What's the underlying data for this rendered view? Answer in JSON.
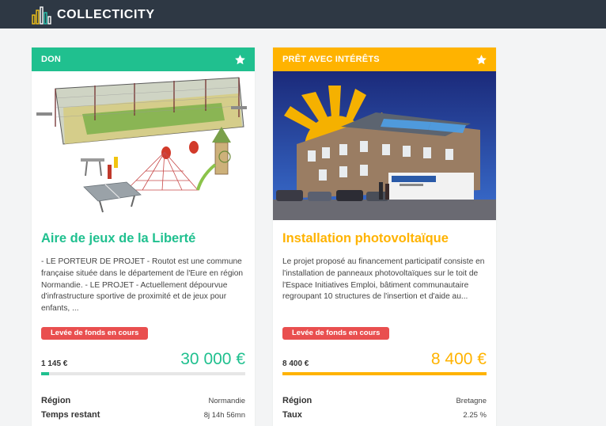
{
  "brand": {
    "name": "COLLECTICITY",
    "logo_icon": "city-buildings-icon",
    "colors": {
      "navbar": "#2e3844",
      "logo_accent": "#f5c518"
    }
  },
  "projects": [
    {
      "category": "DON",
      "accent_color": "#20c08f",
      "favorite_icon": "star-icon",
      "title": "Aire de jeux de la Liberté",
      "description": "- LE PORTEUR DE PROJET - Routot est une commune française située dans le département de l'Eure en région Normandie. - LE PROJET - Actuellement dépourvue d'infrastructure sportive de proximité et de jeux pour enfants, ...",
      "status": "Levée de fonds en cours",
      "raised": "1 145 €",
      "goal": "30 000 €",
      "progress_fraction": 0.04,
      "details": [
        {
          "label": "Région",
          "value": "Normandie"
        },
        {
          "label": "Temps restant",
          "value": "8j 14h 56mn"
        }
      ]
    },
    {
      "category": "PRÊT AVEC INTÉRÊTS",
      "accent_color": "#ffb300",
      "favorite_icon": "star-icon",
      "title": "Installation photovoltaïque",
      "description": "Le projet proposé au financement participatif consiste en l'installation de panneaux photovoltaïques sur le toit de l'Espace Initiatives Emploi, bâtiment communautaire regroupant 10 structures de l'insertion et d'aide au...",
      "status": "Levée de fonds en cours",
      "raised": "8 400 €",
      "goal": "8 400 €",
      "progress_fraction": 1.0,
      "details": [
        {
          "label": "Région",
          "value": "Bretagne"
        },
        {
          "label": "Taux",
          "value": "2.25 %"
        }
      ]
    }
  ]
}
